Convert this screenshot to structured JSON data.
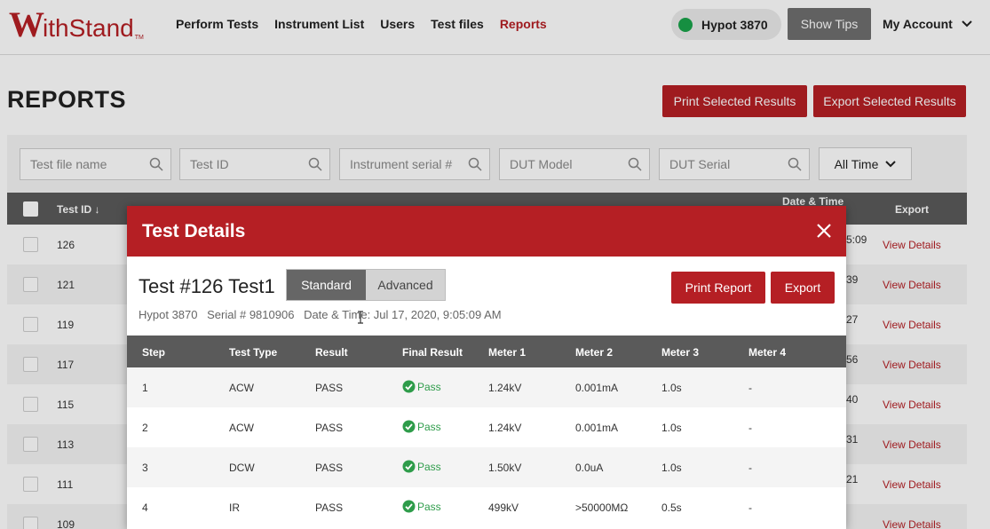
{
  "header": {
    "logo_w": "W",
    "logo_rest": "ithStand",
    "logo_tm": "TM",
    "nav": [
      {
        "label": "Perform Tests",
        "active": false
      },
      {
        "label": "Instrument List",
        "active": false
      },
      {
        "label": "Users",
        "active": false
      },
      {
        "label": "Test files",
        "active": false
      },
      {
        "label": "Reports",
        "active": true
      }
    ],
    "instrument": {
      "label": "Hypot 3870",
      "status_color": "#1aa34a"
    },
    "show_tips": "Show Tips",
    "account": "My Account"
  },
  "page": {
    "title": "REPORTS",
    "print_selected": "Print Selected Results",
    "export_selected": "Export Selected Results",
    "filters": [
      {
        "placeholder": "Test file name"
      },
      {
        "placeholder": "Test ID"
      },
      {
        "placeholder": "Instrument serial #"
      },
      {
        "placeholder": "DUT Model"
      },
      {
        "placeholder": "DUT Serial"
      }
    ],
    "time_filter": "All Time",
    "table": {
      "test_id_header": "Test ID ↓",
      "date_header": "Date & Time",
      "export_header": "Export",
      "rows": [
        {
          "id": "126",
          "time": "5:09",
          "link": "View Details"
        },
        {
          "id": "121",
          "time": "39",
          "link": "View Details"
        },
        {
          "id": "119",
          "time": "27",
          "link": "View Details"
        },
        {
          "id": "117",
          "time": "56",
          "link": "View Details"
        },
        {
          "id": "115",
          "time": "40",
          "link": "View Details"
        },
        {
          "id": "113",
          "time": "31",
          "link": "View Details"
        },
        {
          "id": "111",
          "time": "21",
          "link": "View Details"
        },
        {
          "id": "109",
          "time": "",
          "link": "View Details"
        }
      ]
    }
  },
  "modal": {
    "title": "Test Details",
    "test_name": "Test #126 Test1",
    "toggle": {
      "standard": "Standard",
      "advanced": "Advanced"
    },
    "print_report": "Print Report",
    "export": "Export",
    "meta": {
      "instrument": "Hypot 3870",
      "serial": "Serial # 9810906",
      "datetime": "Date & Time: Jul 17, 2020, 9:05:09 AM"
    },
    "columns": [
      "Step",
      "Test Type",
      "Result",
      "Final Result",
      "Meter 1",
      "Meter 2",
      "Meter 3",
      "Meter 4"
    ],
    "rows": [
      {
        "step": "1",
        "type": "ACW",
        "result": "PASS",
        "final": "Pass",
        "m1": "1.24kV",
        "m2": "0.001mA",
        "m3": "1.0s",
        "m4": "-"
      },
      {
        "step": "2",
        "type": "ACW",
        "result": "PASS",
        "final": "Pass",
        "m1": "1.24kV",
        "m2": "0.001mA",
        "m3": "1.0s",
        "m4": "-"
      },
      {
        "step": "3",
        "type": "DCW",
        "result": "PASS",
        "final": "Pass",
        "m1": "1.50kV",
        "m2": "0.0uA",
        "m3": "1.0s",
        "m4": "-"
      },
      {
        "step": "4",
        "type": "IR",
        "result": "PASS",
        "final": "Pass",
        "m1": "499kV",
        "m2": ">50000MΩ",
        "m3": "0.5s",
        "m4": "-"
      }
    ]
  },
  "colors": {
    "brand": "#b51f24",
    "pass": "#2e9c4a",
    "table_header": "#5a5a5a"
  }
}
